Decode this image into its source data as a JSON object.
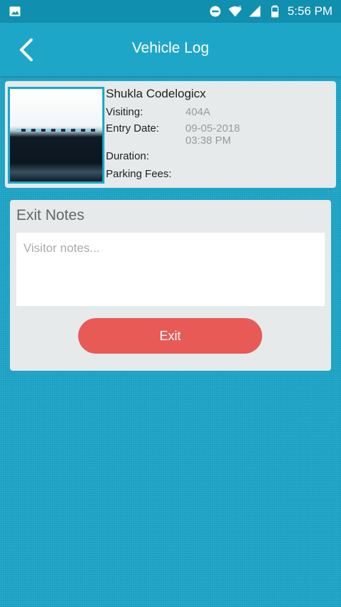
{
  "status_bar": {
    "time": "5:56 PM",
    "icons": [
      "image-icon",
      "do-not-disturb-icon",
      "wifi-icon",
      "signal-icon",
      "battery-icon"
    ]
  },
  "app_bar": {
    "title": "Vehicle Log",
    "back_icon": "chevron-left-icon"
  },
  "vehicle": {
    "name": "Shukla Codelogicx",
    "visiting_label": "Visiting:",
    "visiting_value": "404A",
    "entry_date_label": "Entry Date:",
    "entry_date_value": "09-05-2018",
    "entry_time_value": "03:38 PM",
    "duration_label": "Duration:",
    "parking_fees_label": "Parking Fees:"
  },
  "exit_notes": {
    "title": "Exit Notes",
    "placeholder": "Visitor notes...",
    "value": "",
    "exit_button_label": "Exit"
  },
  "colors": {
    "primary": "#1ea6c8",
    "status_bar": "#118fae",
    "card_bg": "#e6eaea",
    "exit_button": "#e85a56"
  }
}
